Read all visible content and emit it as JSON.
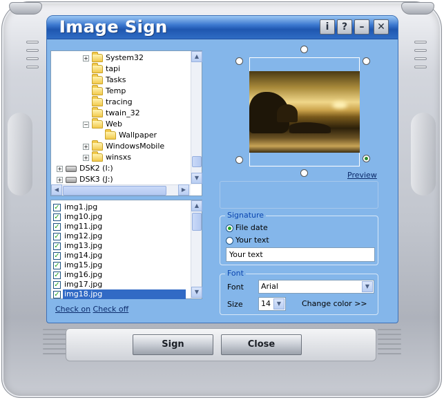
{
  "window": {
    "title": "Image Sign",
    "buttons": {
      "info": "i",
      "help": "?",
      "minimize": "–",
      "close": "✕"
    }
  },
  "tree": {
    "items": [
      {
        "label": "System32",
        "expander": "+",
        "icon": "folder-icon"
      },
      {
        "label": "tapi",
        "expander": "",
        "icon": "folder-icon"
      },
      {
        "label": "Tasks",
        "expander": "",
        "icon": "folder-icon"
      },
      {
        "label": "Temp",
        "expander": "",
        "icon": "folder-icon"
      },
      {
        "label": "tracing",
        "expander": "",
        "icon": "folder-icon"
      },
      {
        "label": "twain_32",
        "expander": "",
        "icon": "folder-icon"
      },
      {
        "label": "Web",
        "expander": "−",
        "icon": "folder-open-icon"
      },
      {
        "label": "Wallpaper",
        "expander": "",
        "icon": "folder-icon"
      },
      {
        "label": "WindowsMobile",
        "expander": "+",
        "icon": "folder-icon"
      },
      {
        "label": "winsxs",
        "expander": "+",
        "icon": "folder-icon"
      },
      {
        "label": "DSK2 (I:)",
        "expander": "+",
        "icon": "drive-icon"
      },
      {
        "label": "DSK3 (J:)",
        "expander": "+",
        "icon": "drive-icon"
      }
    ]
  },
  "files": {
    "items": [
      {
        "name": "img1.jpg",
        "checked": true
      },
      {
        "name": "img10.jpg",
        "checked": true
      },
      {
        "name": "img11.jpg",
        "checked": true
      },
      {
        "name": "img12.jpg",
        "checked": true
      },
      {
        "name": "img13.jpg",
        "checked": true
      },
      {
        "name": "img14.jpg",
        "checked": true
      },
      {
        "name": "img15.jpg",
        "checked": true
      },
      {
        "name": "img16.jpg",
        "checked": true
      },
      {
        "name": "img17.jpg",
        "checked": true
      },
      {
        "name": "img18.jpg",
        "checked": true,
        "selected": true
      }
    ]
  },
  "links": {
    "check_on": "Check on",
    "check_off": "Check off"
  },
  "preview": {
    "link": "Preview"
  },
  "signature": {
    "title": "Signature",
    "option_file_date": "File date",
    "option_your_text": "Your text",
    "selected": "File date",
    "text_value": "Your text"
  },
  "font": {
    "title": "Font",
    "font_label": "Font",
    "font_value": "Arial",
    "size_label": "Size",
    "size_value": "14",
    "change_color": "Change color >>"
  },
  "actions": {
    "sign": "Sign",
    "close": "Close"
  },
  "colors": {
    "panel": "#84b6ea",
    "title_gradient_top": "#9cc8f4",
    "title_gradient_mid": "#1f57b0",
    "group_title": "#0a45b0",
    "selection": "#316ac5",
    "check": "#21a121"
  }
}
